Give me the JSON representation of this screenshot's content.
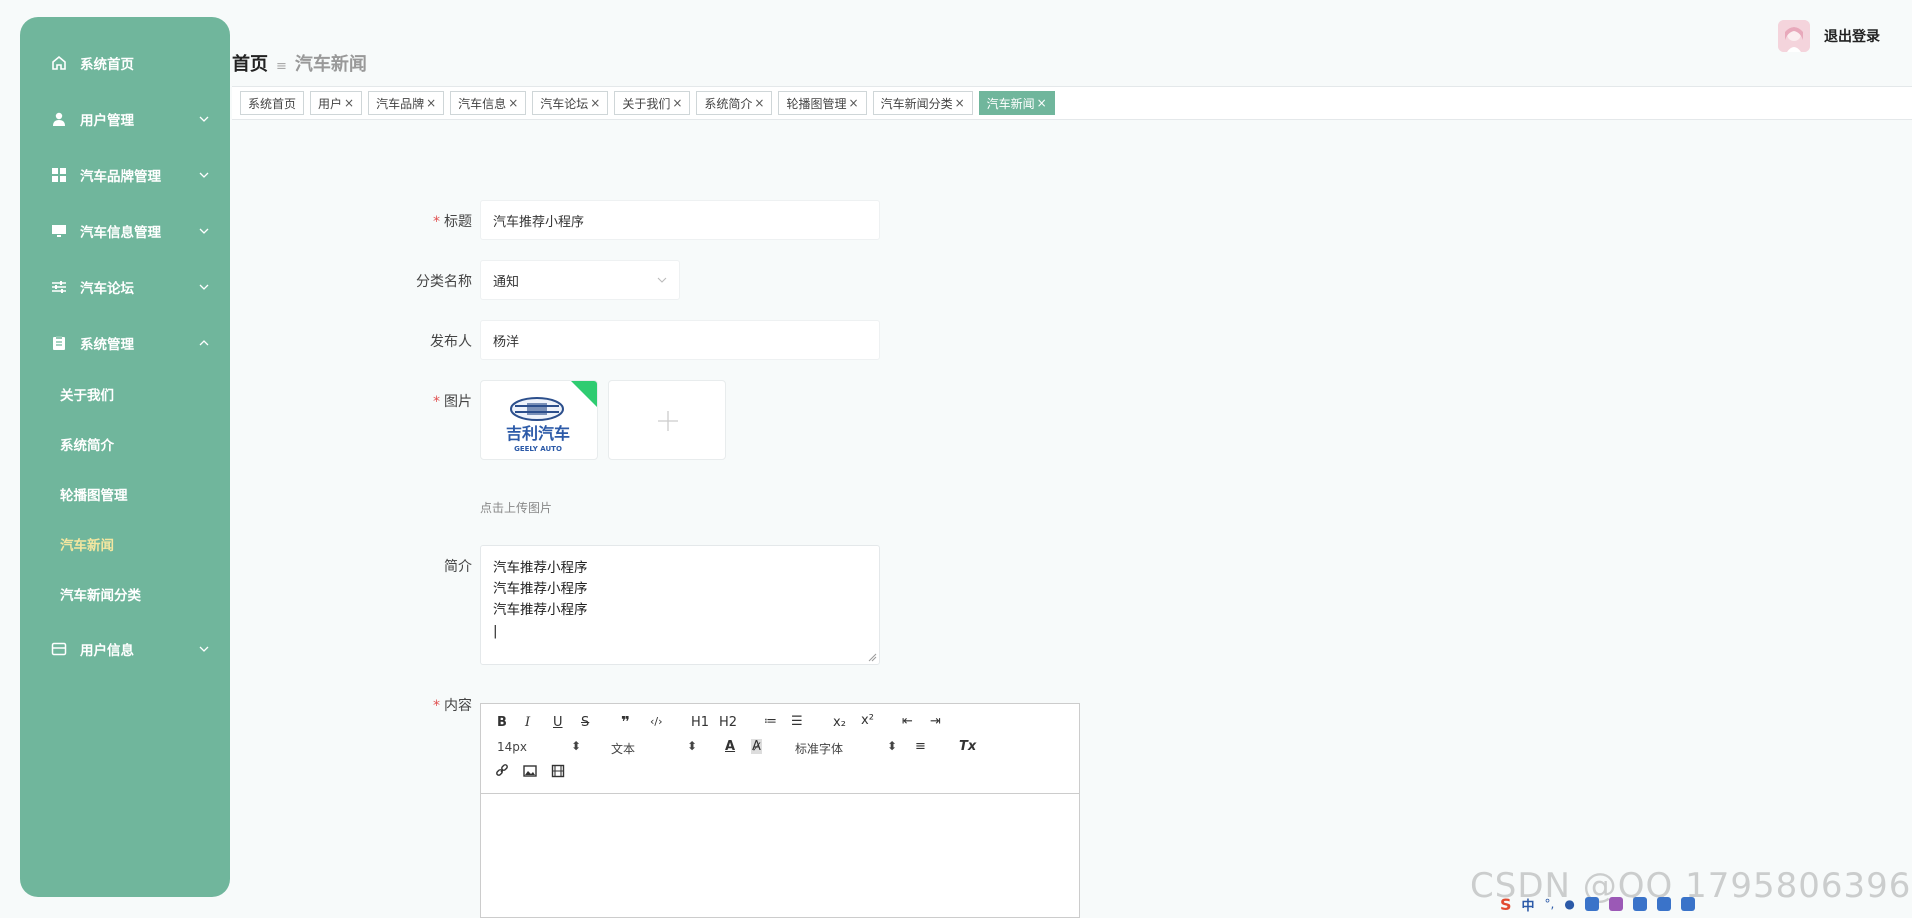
{
  "sidebar": {
    "menus": [
      {
        "label": "系统首页"
      },
      {
        "label": "用户管理"
      },
      {
        "label": "汽车品牌管理"
      },
      {
        "label": "汽车信息管理"
      },
      {
        "label": "汽车论坛"
      },
      {
        "label": "系统管理"
      },
      {
        "label": "用户信息"
      }
    ],
    "sub_items": [
      {
        "label": "关于我们"
      },
      {
        "label": "系统简介"
      },
      {
        "label": "轮播图管理"
      },
      {
        "label": "汽车新闻"
      },
      {
        "label": "汽车新闻分类"
      }
    ]
  },
  "header": {
    "breadcrumb_home": "首页",
    "breadcrumb_sep": "≡",
    "breadcrumb_current": "汽车新闻",
    "logout": "退出登录"
  },
  "tags": [
    {
      "label": "系统首页",
      "closable": false
    },
    {
      "label": "用户",
      "closable": true
    },
    {
      "label": "汽车品牌",
      "closable": true
    },
    {
      "label": "汽车信息",
      "closable": true
    },
    {
      "label": "汽车论坛",
      "closable": true
    },
    {
      "label": "关于我们",
      "closable": true
    },
    {
      "label": "系统简介",
      "closable": true
    },
    {
      "label": "轮播图管理",
      "closable": true
    },
    {
      "label": "汽车新闻分类",
      "closable": true
    },
    {
      "label": "汽车新闻",
      "closable": true,
      "active": true
    }
  ],
  "form": {
    "title_label": "标题",
    "title_value": "汽车推荐小程序",
    "category_label": "分类名称",
    "category_value": "通知",
    "publisher_label": "发布人",
    "publisher_value": "杨洋",
    "image_label": "图片",
    "image_logo_cn": "吉利汽车",
    "image_logo_en": "GEELY AUTO",
    "upload_tip": "点击上传图片",
    "intro_label": "简介",
    "intro_lines": [
      "汽车推荐小程序",
      "汽车推荐小程序",
      "汽车推荐小程序",
      "|"
    ],
    "content_label": "内容"
  },
  "editor": {
    "font_size": "14px",
    "block_type": "文本",
    "font_family": "标准字体",
    "buttons": [
      "B",
      "I",
      "U",
      "S",
      "❞",
      "‹/›",
      "H1",
      "H2",
      "≔",
      "☰",
      "x₂",
      "x²",
      "⇤",
      "⇥",
      "A",
      "A̷",
      "≡",
      "Tx"
    ]
  },
  "watermark": "CSDN @QQ 1795806396",
  "colors": {
    "sidebar": "#70b69c",
    "active_tag": "#70b69c",
    "required": "#e05050",
    "active_sub": "#f3e6a0"
  }
}
